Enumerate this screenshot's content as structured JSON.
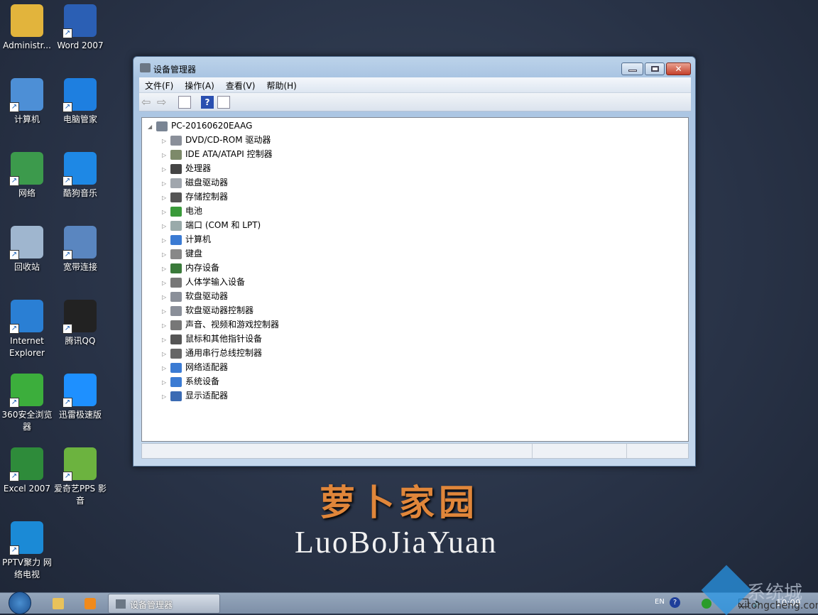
{
  "desktop": {
    "icons": [
      {
        "label": "Administr...",
        "icon": "user-folder-icon",
        "color": "#e2b43c"
      },
      {
        "label": "Word 2007",
        "icon": "word-icon",
        "color": "#2b5fb4"
      },
      {
        "label": "计算机",
        "icon": "computer-icon",
        "color": "#4d8fd6"
      },
      {
        "label": "电脑管家",
        "icon": "shield-icon",
        "color": "#1e7fe0"
      },
      {
        "label": "网络",
        "icon": "network-globe-icon",
        "color": "#3c9a4c"
      },
      {
        "label": "酷狗音乐",
        "icon": "kugou-icon",
        "color": "#1e88e5"
      },
      {
        "label": "回收站",
        "icon": "recycle-bin-icon",
        "color": "#9fb6cf"
      },
      {
        "label": "宽带连接",
        "icon": "broadband-icon",
        "color": "#5a86c0"
      },
      {
        "label": "Internet Explorer",
        "icon": "ie-icon",
        "color": "#2a7fd4"
      },
      {
        "label": "腾讯QQ",
        "icon": "qq-penguin-icon",
        "color": "#222222"
      },
      {
        "label": "360安全浏览器",
        "icon": "browser-360-icon",
        "color": "#3cae3c"
      },
      {
        "label": "迅雷极速版",
        "icon": "xunlei-icon",
        "color": "#1e90ff"
      },
      {
        "label": "Excel 2007",
        "icon": "excel-icon",
        "color": "#2e8b3a"
      },
      {
        "label": "爱奇艺PPS 影音",
        "icon": "iqiyi-icon",
        "color": "#6cb33f"
      },
      {
        "label": "PPTV聚力 网络电视",
        "icon": "pptv-icon",
        "color": "#1b8ad6"
      }
    ]
  },
  "window": {
    "title": "设备管理器",
    "menu": [
      "文件(F)",
      "操作(A)",
      "查看(V)",
      "帮助(H)"
    ],
    "tree": {
      "root": "PC-20160620EAAG",
      "items": [
        "DVD/CD-ROM 驱动器",
        "IDE ATA/ATAPI 控制器",
        "处理器",
        "磁盘驱动器",
        "存储控制器",
        "电池",
        "端口 (COM 和 LPT)",
        "计算机",
        "键盘",
        "内存设备",
        "人体学输入设备",
        "软盘驱动器",
        "软盘驱动器控制器",
        "声音、视频和游戏控制器",
        "鼠标和其他指针设备",
        "通用串行总线控制器",
        "网络适配器",
        "系统设备",
        "显示适配器"
      ]
    }
  },
  "wallpaper": {
    "logo_cn": "萝卜家园",
    "logo_en": "LuoBoJiaYuan"
  },
  "taskbar": {
    "active_task": "设备管理器",
    "lang": "EN",
    "clock": "10:09"
  },
  "watermark": {
    "cn": "系统城",
    "url": "xitongcheng.com"
  }
}
